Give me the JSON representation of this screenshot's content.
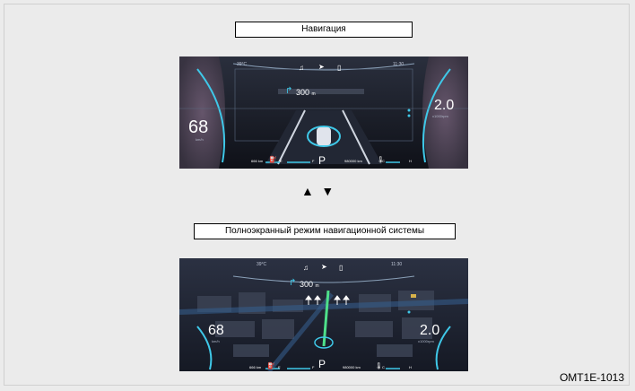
{
  "section1": {
    "label": "Навигация"
  },
  "section2": {
    "label": "Полноэкранный режим навигационной системы"
  },
  "arrows": {
    "up": "▲",
    "down": "▼"
  },
  "figure_code": "OMT1E-1013",
  "cluster_standard": {
    "temperature": "39°C",
    "clock": "11:30",
    "turn_distance": "300",
    "turn_unit": "m",
    "speed": "68",
    "speed_unit": "km/h",
    "rpm": "2.0",
    "rpm_unit": "x1000rpm",
    "gear": "P",
    "range_value": "666",
    "range_unit": "km",
    "fuel_empty": "E",
    "fuel_full": "F",
    "odometer": "980000",
    "odometer_unit": "km",
    "temp_cold": "C",
    "temp_hot": "H"
  },
  "cluster_fullscreen": {
    "temperature": "39°C",
    "clock": "11:30",
    "turn_distance": "300",
    "turn_unit": "m",
    "speed": "68",
    "speed_unit": "km/h",
    "rpm": "2.0",
    "rpm_unit": "x1000rpm",
    "gear": "P",
    "range_value": "666",
    "range_unit": "km",
    "fuel_empty": "E",
    "fuel_full": "F",
    "odometer": "980000",
    "odometer_unit": "km",
    "temp_cold": "C",
    "temp_hot": "H"
  },
  "colors": {
    "accent": "#3fc8e8",
    "nav_route": "#4ee08a",
    "background": "#ebebeb"
  },
  "icons": [
    "music-icon",
    "navigation-arrow-icon",
    "phone-icon",
    "turn-right-icon",
    "fuel-pump-icon",
    "coolant-temp-icon",
    "car-icon"
  ]
}
